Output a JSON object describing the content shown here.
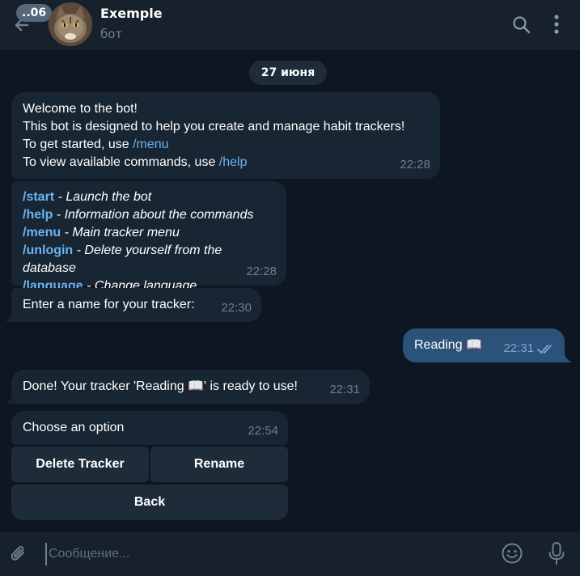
{
  "header": {
    "unread_badge": "..06",
    "title": "Exemple",
    "subtitle": "бот"
  },
  "date_pill": "27 июня",
  "messages": {
    "welcome": {
      "line1": "Welcome to the bot!",
      "line2": "This bot is designed to help you create and manage habit trackers!",
      "line3_prefix": "To get started, use ",
      "line3_cmd": "/menu",
      "line4_prefix": "To view available commands, use ",
      "line4_cmd": "/help",
      "time": "22:28"
    },
    "commands": {
      "items": [
        {
          "cmd": "/start",
          "desc": " - Launch the bot"
        },
        {
          "cmd": "/help",
          "desc": " - Information about the commands"
        },
        {
          "cmd": "/menu",
          "desc": " - Main tracker menu"
        },
        {
          "cmd": "/unlogin",
          "desc": " - Delete yourself from the database"
        },
        {
          "cmd": "/language",
          "desc": " - Change language"
        }
      ],
      "time": "22:28"
    },
    "enter_name": {
      "text": "Enter a name for your tracker:",
      "time": "22:30"
    },
    "outgoing": {
      "text": "Reading 📖",
      "time": "22:31"
    },
    "done": {
      "text": "Done! Your tracker 'Reading 📖' is ready to use!",
      "time": "22:31"
    },
    "choose": {
      "text": "Choose an option",
      "time": "22:54"
    }
  },
  "keyboard": {
    "delete_tracker": "Delete Tracker",
    "rename": "Rename",
    "back": "Back"
  },
  "composer": {
    "placeholder": "Сообщение..."
  },
  "colors": {
    "background": "#0e1621",
    "header": "#17212b",
    "incoming_bubble": "#182533",
    "outgoing_bubble": "#2b5278",
    "link": "#6ab3f3",
    "muted": "#6d7f8f"
  },
  "icons": [
    "back-arrow-icon",
    "search-icon",
    "more-vertical-icon",
    "paperclip-icon",
    "emoji-icon",
    "microphone-icon",
    "double-check-icon"
  ]
}
